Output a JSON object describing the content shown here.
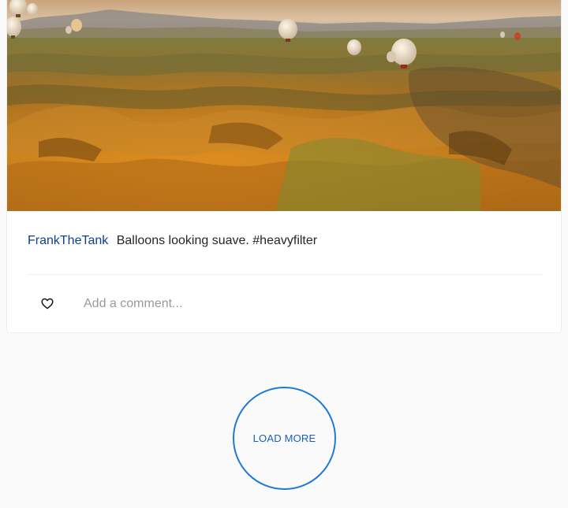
{
  "post": {
    "username": "FrankTheTank",
    "caption": "Balloons looking suave. #heavyfilter",
    "photo_subject": "Hot air balloons over a canyon landscape at sunset",
    "like_icon": "heart-outline-icon",
    "comment_placeholder": "Add a comment..."
  },
  "feed": {
    "load_more_label": "LOAD MORE"
  },
  "colors": {
    "username": "#0d3f8c",
    "load_more_border": "#1f7ad6",
    "load_more_text": "#1a5fb0",
    "background": "#fafafa"
  }
}
